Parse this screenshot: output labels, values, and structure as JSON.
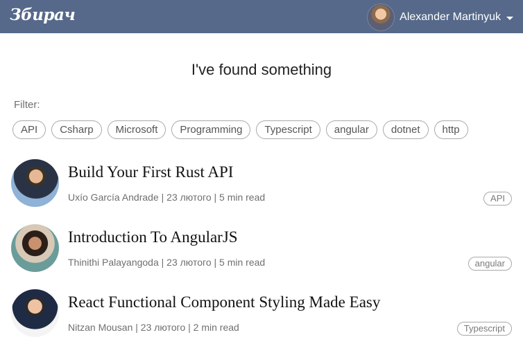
{
  "app": {
    "logo_text": "Збирач",
    "user": {
      "name": "Alexander Martinyuk",
      "avatar_icon": "user-avatar"
    }
  },
  "page": {
    "title": "I've found something",
    "filter_label": "Filter:",
    "filters": [
      "API",
      "Csharp",
      "Microsoft",
      "Programming",
      "Typescript",
      "angular",
      "dotnet",
      "http"
    ]
  },
  "articles": [
    {
      "title": "Build Your First Rust API",
      "author": "Uxío García Andrade",
      "date": "23 лютого",
      "read_time": "5 min read",
      "meta": "Uxío García Andrade | 23 лютого | 5 min read",
      "tag": "API"
    },
    {
      "title": "Introduction To AngularJS",
      "author": "Thinithi Palayangoda",
      "date": "23 лютого",
      "read_time": "5 min read",
      "meta": "Thinithi Palayangoda | 23 лютого | 5 min read",
      "tag": "angular"
    },
    {
      "title": "React Functional Component Styling Made Easy",
      "author": "Nitzan Mousan",
      "date": "23 лютого",
      "read_time": "2 min read",
      "meta": "Nitzan Mousan | 23 лютого | 2 min read",
      "tag": "Typescript"
    }
  ],
  "colors": {
    "header_bg": "#56698a",
    "chip_border": "#a8a8a8",
    "meta_text": "#6f6f6f"
  }
}
